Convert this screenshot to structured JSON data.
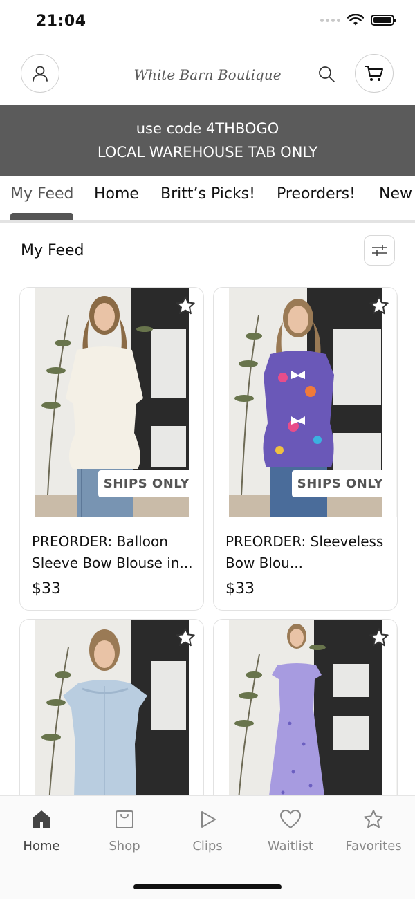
{
  "status_bar": {
    "time": "21:04"
  },
  "header": {
    "logo_text": "White Barn Boutique",
    "account_icon": "user-icon",
    "search_icon": "search-icon",
    "cart_icon": "cart-icon"
  },
  "promo": {
    "line1": "use code 4THBOGO",
    "line2": "LOCAL WAREHOUSE TAB ONLY",
    "background": "#5b5b5b"
  },
  "tabs": [
    {
      "label": "My Feed",
      "active": true
    },
    {
      "label": "Home"
    },
    {
      "label": "Britt’s Picks!"
    },
    {
      "label": "Preorders!"
    },
    {
      "label": "New"
    }
  ],
  "feed": {
    "title": "My Feed",
    "filter_icon": "sliders-icon",
    "products": [
      {
        "title": "PREORDER: Balloon Sleeve Bow Blouse in...",
        "price": "$33",
        "badge": "SHIPS ONLY"
      },
      {
        "title": "PREORDER: Sleeveless Bow Blou...",
        "price": "$33",
        "badge": "SHIPS ONLY"
      },
      {
        "title": "",
        "price": ""
      },
      {
        "title": "",
        "price": ""
      }
    ]
  },
  "bottom_nav": [
    {
      "label": "Home",
      "icon": "home-icon",
      "active": true
    },
    {
      "label": "Shop",
      "icon": "shopping-bag-icon"
    },
    {
      "label": "Clips",
      "icon": "play-icon"
    },
    {
      "label": "Waitlist",
      "icon": "heart-icon"
    },
    {
      "label": "Favorites",
      "icon": "star-icon"
    }
  ]
}
